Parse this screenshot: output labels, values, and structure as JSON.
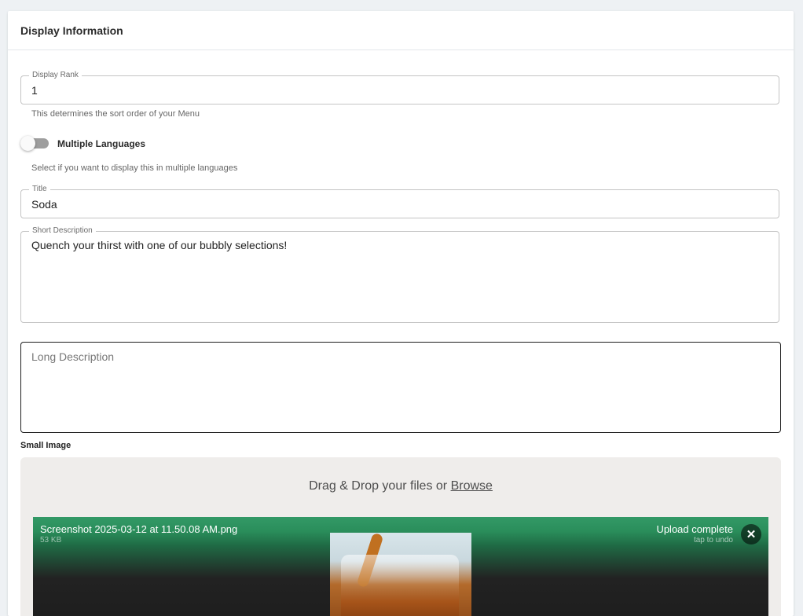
{
  "card": {
    "title": "Display Information"
  },
  "display_rank": {
    "label": "Display Rank",
    "value": "1",
    "helper": "This determines the sort order of your Menu"
  },
  "multiple_languages": {
    "label": "Multiple Languages",
    "enabled": false,
    "helper": "Select if you want to display this in multiple languages"
  },
  "title_field": {
    "label": "Title",
    "value": "Soda"
  },
  "short_description": {
    "label": "Short Description",
    "value": "Quench your thirst with one of our bubbly selections!"
  },
  "long_description": {
    "placeholder": "Long Description",
    "value": ""
  },
  "small_image": {
    "label": "Small Image",
    "drop_text": "Drag & Drop your files or",
    "browse_text": "Browse",
    "file": {
      "name": "Screenshot 2025-03-12 at 11.50.08 AM.png",
      "size": "53 KB",
      "status": "Upload complete",
      "status_sub": "tap to undo",
      "remove_icon": "close-icon"
    }
  },
  "colors": {
    "upload_success": "#339966",
    "toggle_track": "#9e9e9e",
    "page_bg": "#eef1f4"
  }
}
